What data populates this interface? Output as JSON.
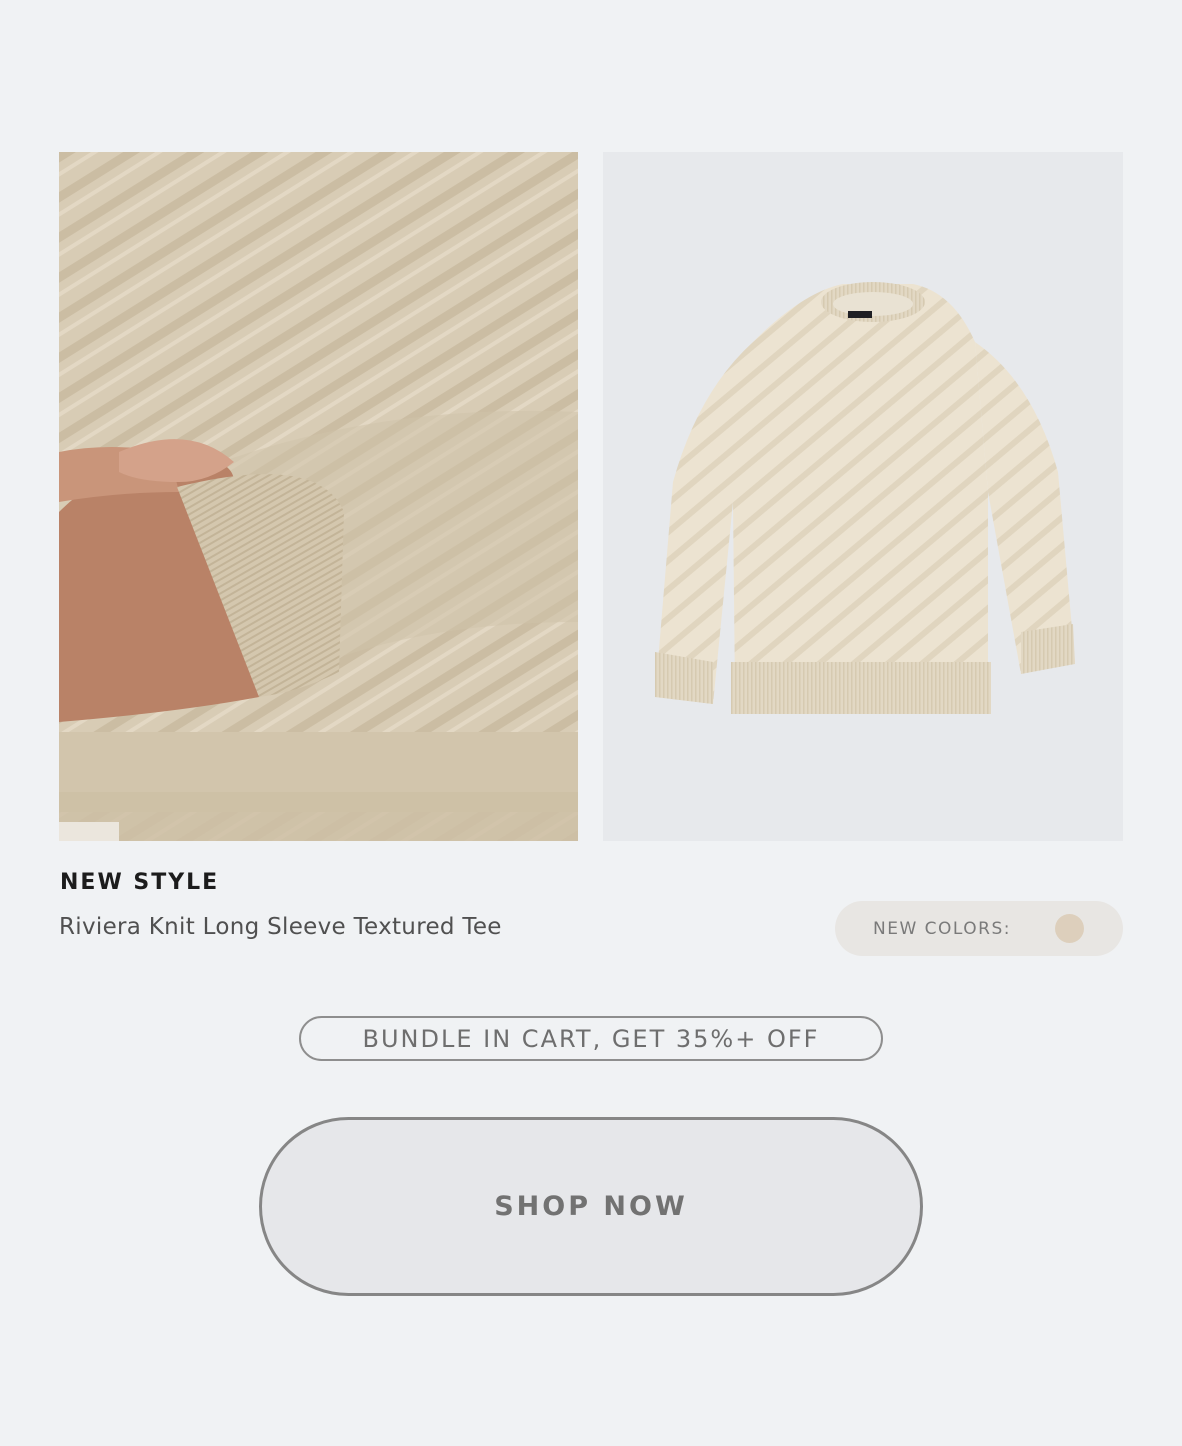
{
  "hero": {
    "lifestyle_image": "arm-crossed-knit-sweater-closeup",
    "product_image": "cream-knit-long-sleeve-tee-flatlay"
  },
  "product": {
    "eyebrow": "NEW STYLE",
    "name": "Riviera Knit Long Sleeve Textured Tee"
  },
  "colors": {
    "label": "NEW COLORS:",
    "swatches": [
      "#ddcfbc"
    ]
  },
  "promo": {
    "badge_text": "BUNDLE IN CART, GET 35%+ OFF"
  },
  "cta": {
    "label": "SHOP NOW"
  }
}
